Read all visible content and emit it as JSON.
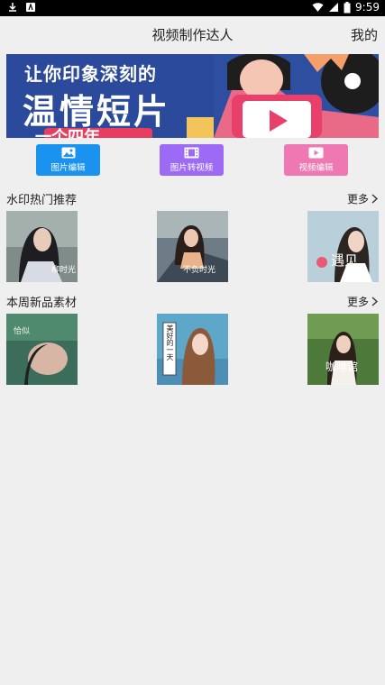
{
  "status_bar": {
    "time": "9:59",
    "left_icons": [
      "download-icon",
      "app-notification-icon"
    ],
    "right_icons": [
      "wifi-icon",
      "signal-icon",
      "battery-icon"
    ]
  },
  "app_bar": {
    "title": "视频制作达人",
    "mine_label": "我的"
  },
  "banner": {
    "line1": "让你印象深刻的",
    "line2": "温情短片",
    "line3": "一个四年"
  },
  "quick_actions": [
    {
      "label": "图片编辑",
      "color": "#1a93f0",
      "icon": "image-icon"
    },
    {
      "label": "图片转视频",
      "color": "#9c6af5",
      "icon": "film-icon"
    },
    {
      "label": "视频编辑",
      "color": "#ef78b2",
      "icon": "video-icon"
    }
  ],
  "sections": [
    {
      "title": "水印热门推荐",
      "more_label": "更多",
      "items": [
        {
          "caption": "柳时光"
        },
        {
          "caption": "不负时光"
        },
        {
          "caption": "遇见"
        }
      ]
    },
    {
      "title": "本周新品素材",
      "more_label": "更多",
      "items": [
        {
          "caption": "恰似"
        },
        {
          "caption": "美好的一天"
        },
        {
          "caption": "咖啡馆"
        }
      ]
    }
  ]
}
